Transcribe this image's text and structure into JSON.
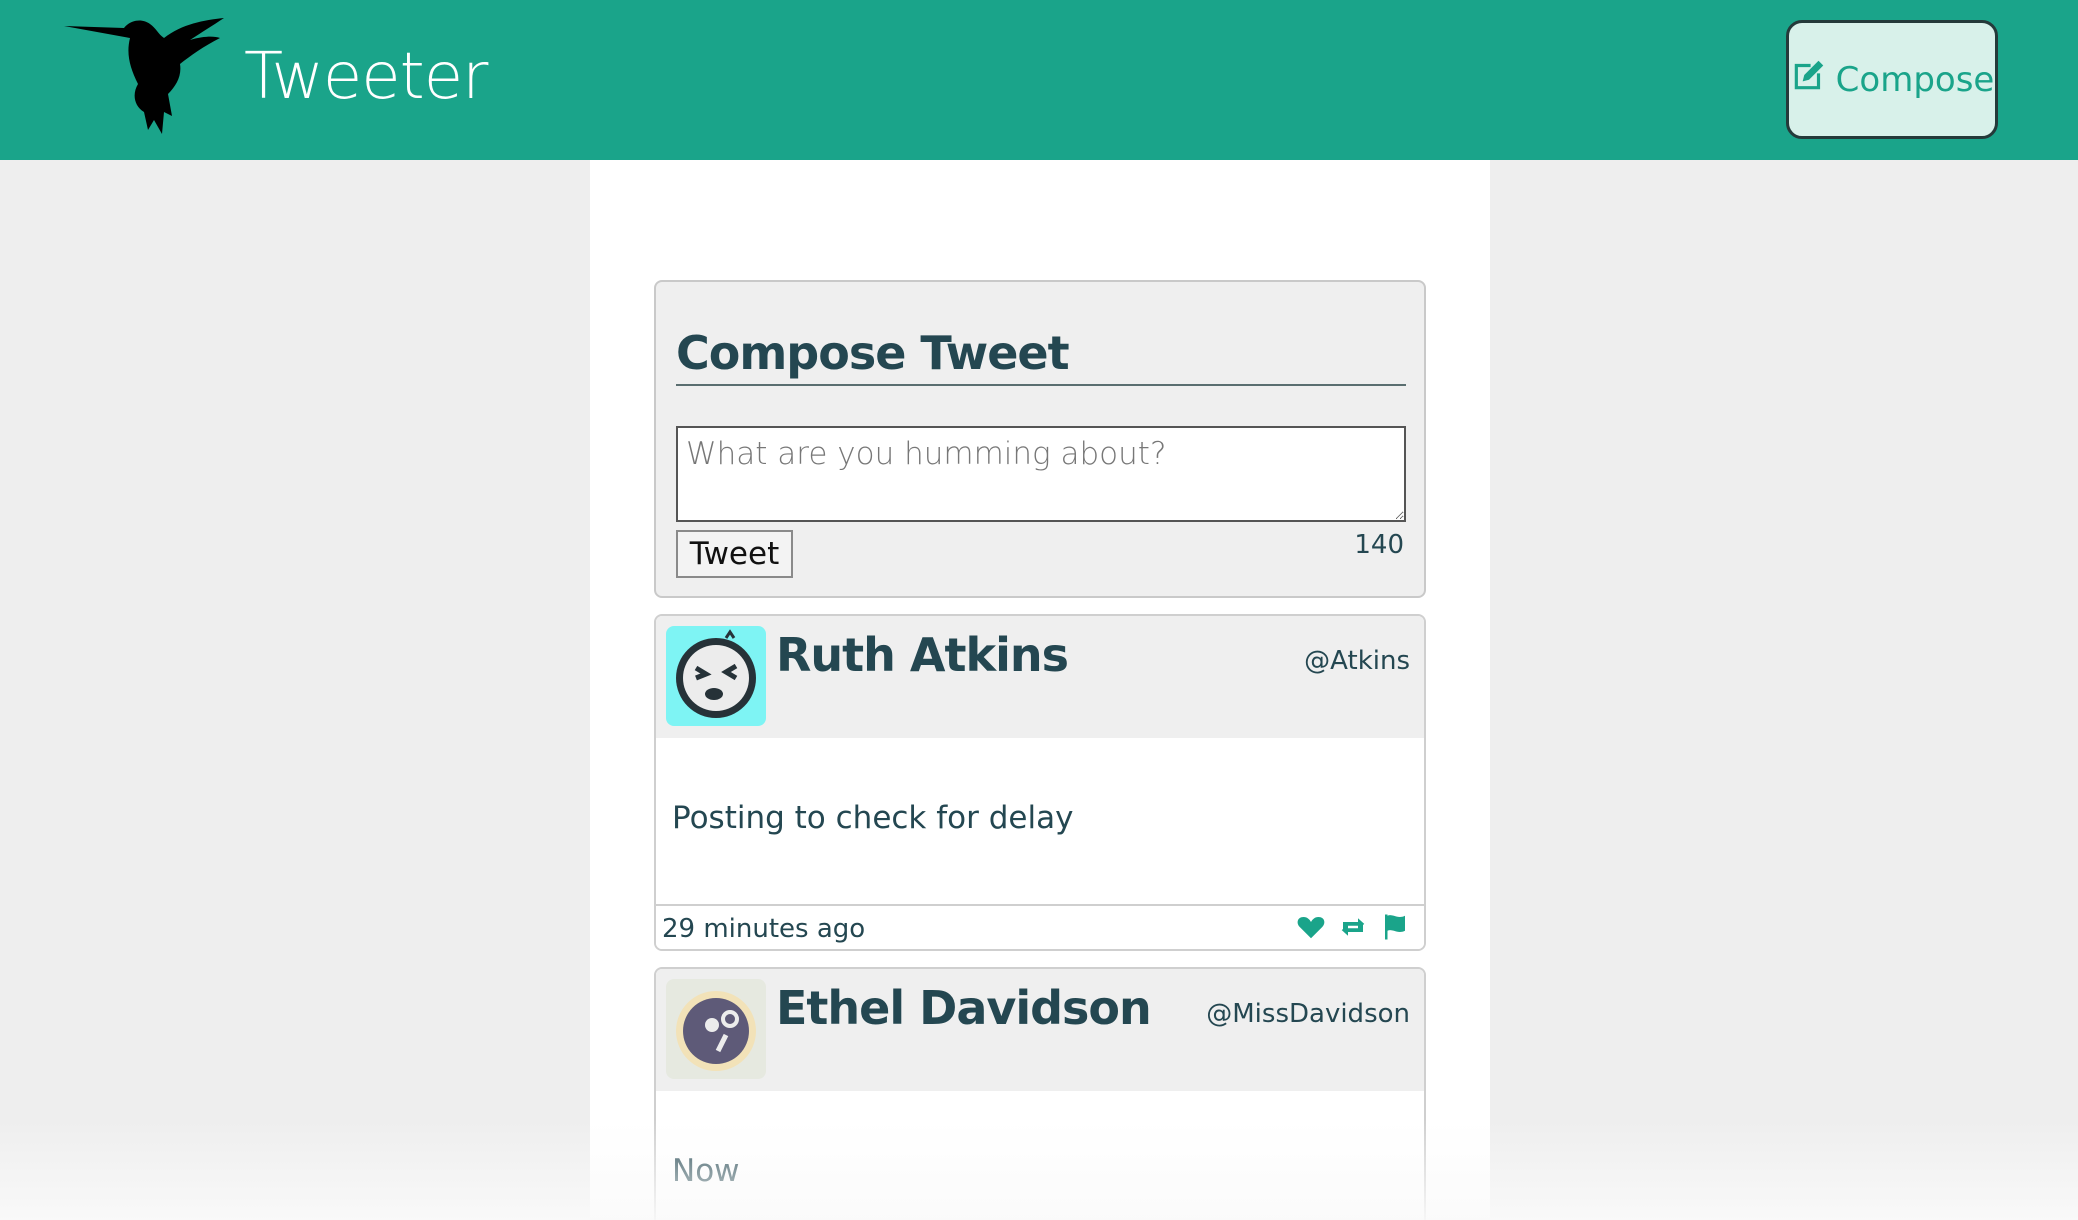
{
  "nav": {
    "brand": "Tweeter",
    "compose_label": "Compose"
  },
  "compose": {
    "title": "Compose Tweet",
    "placeholder": "What are you humming about?",
    "button": "Tweet",
    "counter": "140"
  },
  "tweets": [
    {
      "author": "Ruth Atkins",
      "handle": "@Atkins",
      "content": "Posting to check for delay",
      "time": "29 minutes ago",
      "avatar_color": "#7ef4f4"
    },
    {
      "author": "Ethel Davidson",
      "handle": "@MissDavidson",
      "content": "Now",
      "avatar_color": "#e6e9e0"
    }
  ],
  "colors": {
    "brand": "#1aa48a",
    "text": "#244751"
  },
  "icons": {
    "logo": "hummingbird-icon",
    "compose": "edit-icon",
    "like": "heart-icon",
    "retweet": "retweet-icon",
    "flag": "flag-icon"
  }
}
